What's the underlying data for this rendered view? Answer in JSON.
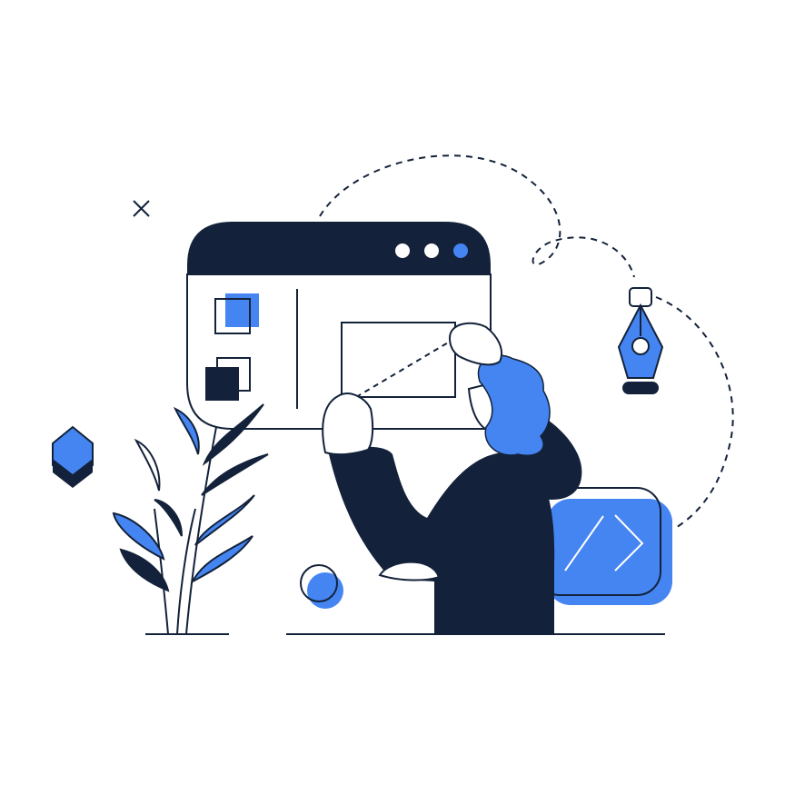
{
  "illustration": {
    "palette": {
      "navy": "#13223A",
      "blue": "#4585F2",
      "white": "#FFFFFF"
    },
    "icons": [
      "browser-window-icon",
      "pen-tool-icon",
      "code-window-icon",
      "plant-icon",
      "cube-icon",
      "cross-mark-icon"
    ]
  }
}
